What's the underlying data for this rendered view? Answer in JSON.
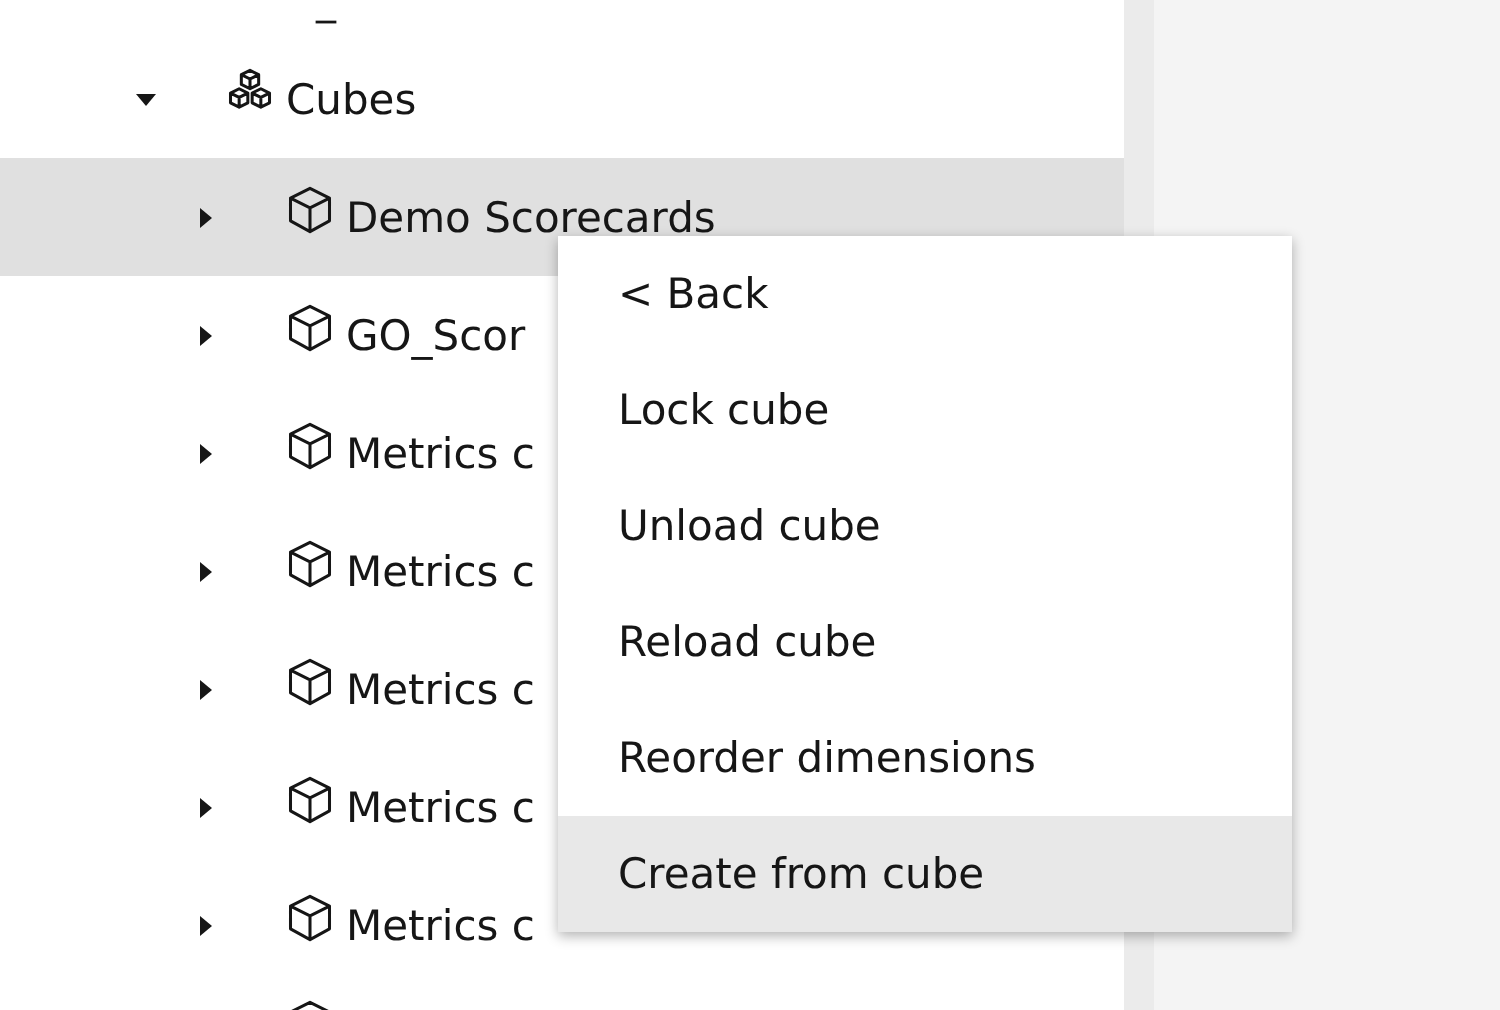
{
  "tree": {
    "top_fragment": "_",
    "node": {
      "label": "Cubes",
      "expanded": true,
      "children": [
        {
          "kind": "cube",
          "label": "Demo Scorecards",
          "expanded": false,
          "selected": true
        },
        {
          "kind": "cube",
          "label": "GO_Scor",
          "expanded": false,
          "selected": false
        },
        {
          "kind": "cube",
          "label": "Metrics c",
          "expanded": false,
          "selected": false
        },
        {
          "kind": "cube",
          "label": "Metrics c",
          "expanded": false,
          "selected": false
        },
        {
          "kind": "cube",
          "label": "Metrics c",
          "expanded": false,
          "selected": false
        },
        {
          "kind": "cube",
          "label": "Metrics c",
          "expanded": false,
          "selected": false
        },
        {
          "kind": "cube",
          "label": "Metrics c",
          "expanded": false,
          "selected": false
        },
        {
          "kind": "partial",
          "selected": false
        }
      ]
    }
  },
  "context_menu": {
    "items": [
      {
        "label": "< Back",
        "selected": false
      },
      {
        "label": "Lock cube",
        "selected": false
      },
      {
        "label": "Unload cube",
        "selected": false
      },
      {
        "label": "Reload cube",
        "selected": false
      },
      {
        "label": "Reorder dimensions",
        "selected": false
      },
      {
        "label": "Create from cube",
        "selected": true
      }
    ]
  }
}
